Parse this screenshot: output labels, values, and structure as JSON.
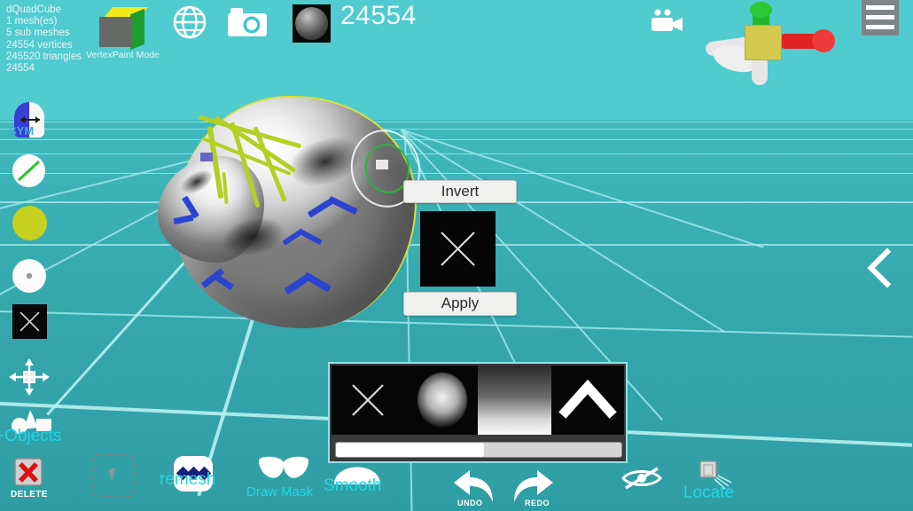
{
  "app": {
    "background_color": "#3ec6ca",
    "accent_color": "#20d7ea",
    "model_outline_color": "#d8e03a"
  },
  "mesh_info": {
    "lines": "dQuadCube\n1 mesh(es)\n5 sub meshes\n24554 vertices\n245520 triangles\n24554",
    "name": "dQuadCube",
    "mesh_count": "1 mesh(es)",
    "sub_meshes": "5 sub meshes",
    "vertices": "24554 vertices",
    "triangles": "245520 triangles",
    "extra": "24554"
  },
  "toolbar": {
    "mode_label": "VertexPaint  Mode",
    "vertex_count": "24554",
    "icons": [
      {
        "name": "cube-icon",
        "label": "VertexPaint  Mode"
      },
      {
        "name": "globe-icon",
        "label": ""
      },
      {
        "name": "camera-icon",
        "label": ""
      },
      {
        "name": "material-sphere-icon",
        "label": ""
      },
      {
        "name": "video-camera-icon",
        "label": ""
      },
      {
        "name": "hamburger-menu-icon",
        "label": ""
      }
    ]
  },
  "sidebar": {
    "symmetry_label": "SYM",
    "items": [
      {
        "name": "symmetry-toggle",
        "label": "SYM"
      },
      {
        "name": "brush-stroke-swatch",
        "label": ""
      },
      {
        "name": "paint-color-swatch",
        "label": ""
      },
      {
        "name": "brush-falloff-swatch",
        "label": ""
      },
      {
        "name": "texture-swatch",
        "label": ""
      },
      {
        "name": "move-tool",
        "label": ""
      },
      {
        "name": "add-objects-tool",
        "label": "+Objects"
      },
      {
        "name": "delete-tool",
        "label": "DELETE"
      }
    ],
    "objects_label": "+Objects",
    "delete_label": "DELETE"
  },
  "mask_panel": {
    "invert_label": "Invert",
    "apply_label": "Apply",
    "thumbnail_name": "mask-x-thumbnail"
  },
  "brush_panel": {
    "slots": [
      {
        "name": "brush-x",
        "label": ""
      },
      {
        "name": "brush-noise",
        "label": ""
      },
      {
        "name": "brush-gradient",
        "label": ""
      },
      {
        "name": "brush-collapse-chevron",
        "label": ""
      }
    ],
    "slider_value": 52
  },
  "bottom_bar": {
    "items": [
      {
        "name": "select-box-tool",
        "label": ""
      },
      {
        "name": "remesh-tool",
        "label": "remesh"
      },
      {
        "name": "draw-mask-tool",
        "label": "Draw Mask"
      },
      {
        "name": "smooth-tool",
        "label": "Smooth"
      },
      {
        "name": "undo-button",
        "label": "UNDO"
      },
      {
        "name": "redo-button",
        "label": "REDO"
      },
      {
        "name": "hide-toggle",
        "label": ""
      },
      {
        "name": "locate-tool",
        "label": "Locate"
      }
    ],
    "remesh_label": "remesh",
    "draw_mask_label": "Draw Mask",
    "smooth_label": "Smooth",
    "undo_label": "UNDO",
    "redo_label": "REDO",
    "locate_label": "Locate"
  },
  "right_panel": {
    "expand_chevron": "chevron-left-icon"
  }
}
